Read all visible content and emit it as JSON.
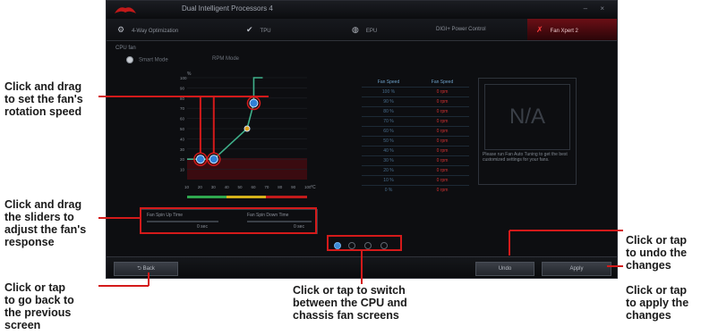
{
  "callouts": {
    "drag_points": "Click and drag\nto set the fan's\nrotation speed",
    "drag_sliders": "Click and drag\nthe sliders to\nadjust the fan's\nresponse",
    "back": "Click or tap\nto go back to\nthe previous\nscreen",
    "switch": "Click or tap to switch\nbetween the CPU and\nchassis fan screens",
    "undo": "Click or tap\nto undo the\nchanges",
    "apply": "Click or tap\nto apply the\nchanges"
  },
  "app": {
    "title": "Dual Intelligent Processors 4",
    "window_controls": "– ×",
    "tabs": [
      {
        "label": "4-Way Optimization",
        "icon": "gears-icon"
      },
      {
        "label": "TPU",
        "icon": "tpu-icon"
      },
      {
        "label": "EPU",
        "icon": "epu-icon"
      },
      {
        "label": "DIGI+ Power Control",
        "icon": "digi-icon"
      },
      {
        "label": "Fan Xpert 2",
        "icon": "fan-icon"
      }
    ],
    "subheader": "CPU fan",
    "modes": [
      "Smart Mode",
      "RPM Mode"
    ],
    "chart_ylabel": "%",
    "chart_xlabel": "°C",
    "y_ticks": [
      "100",
      "90",
      "80",
      "70",
      "60",
      "50",
      "40",
      "30",
      "20",
      "10"
    ],
    "x_ticks": [
      "10",
      "20",
      "30",
      "40",
      "50",
      "60",
      "70",
      "80",
      "90",
      "100"
    ],
    "table": {
      "headers": [
        "Fan Speed",
        "Fan Speed"
      ],
      "rows": [
        [
          "100 %",
          "0 rpm"
        ],
        [
          "90 %",
          "0 rpm"
        ],
        [
          "80 %",
          "0 rpm"
        ],
        [
          "70 %",
          "0 rpm"
        ],
        [
          "60 %",
          "0 rpm"
        ],
        [
          "50 %",
          "0 rpm"
        ],
        [
          "40 %",
          "0 rpm"
        ],
        [
          "30 %",
          "0 rpm"
        ],
        [
          "20 %",
          "0 rpm"
        ],
        [
          "10 %",
          "0 rpm"
        ],
        [
          "0 %",
          "0 rpm"
        ]
      ]
    },
    "na_label": "N/A",
    "na_text": "Please run Fan Auto Tuning to get the best customized settings for your fans.",
    "sliders": {
      "spinup_label": "Fan Spin Up Time",
      "spinup_value": "0 sec",
      "spindown_label": "Fan Spin Down Time",
      "spindown_value": "0 sec"
    },
    "pager_selected": 1,
    "pager_total": 4,
    "buttons": {
      "back": "Back",
      "undo": "Undo",
      "apply": "Apply"
    }
  },
  "colors": {
    "accent_red": "#d01818",
    "curve_green": "#3fb08a",
    "point_blue": "#2f7fd6",
    "highlight": "#d41a1a"
  },
  "chart_data": {
    "type": "line",
    "x": [
      20,
      30,
      55,
      60,
      60
    ],
    "y": [
      20,
      20,
      50,
      75,
      100
    ],
    "xlim": [
      10,
      100
    ],
    "ylim": [
      0,
      100
    ]
  }
}
